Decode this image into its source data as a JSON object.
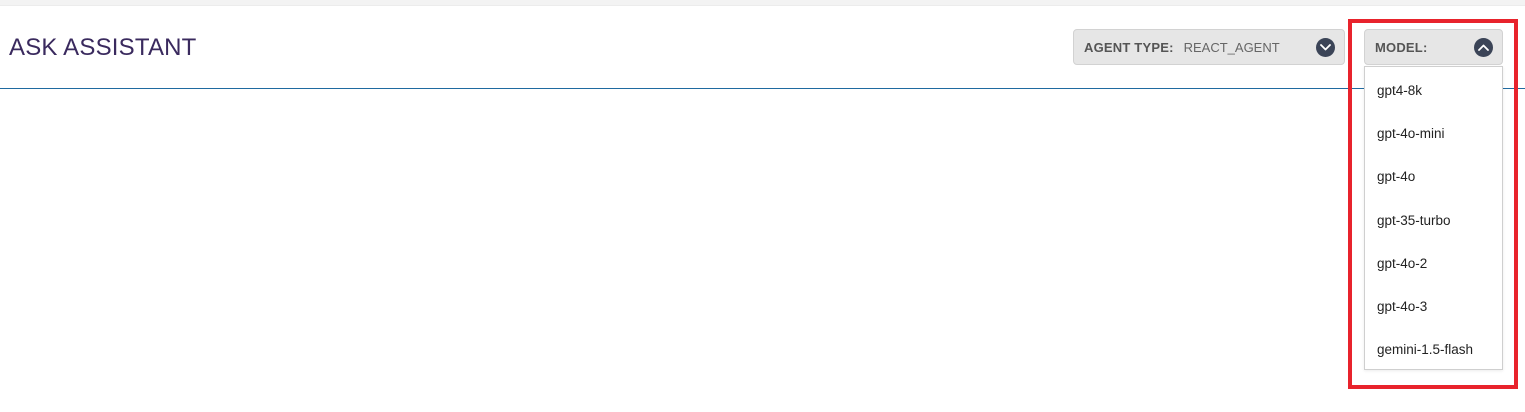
{
  "header": {
    "title": "ASK ASSISTANT"
  },
  "agent_type": {
    "label": "AGENT TYPE:",
    "value": "REACT_AGENT",
    "icon": "chevron-down-icon"
  },
  "model": {
    "label": "MODEL:",
    "value": "",
    "icon": "chevron-up-icon",
    "options": [
      "gpt4-8k",
      "gpt-4o-mini",
      "gpt-4o",
      "gpt-35-turbo",
      "gpt-4o-2",
      "gpt-4o-3",
      "gemini-1.5-flash"
    ]
  },
  "colors": {
    "title": "#3a2a5e",
    "header_rule": "#1f6aa0",
    "chevron_bg": "#3b4457",
    "highlight": "#e8232c"
  }
}
